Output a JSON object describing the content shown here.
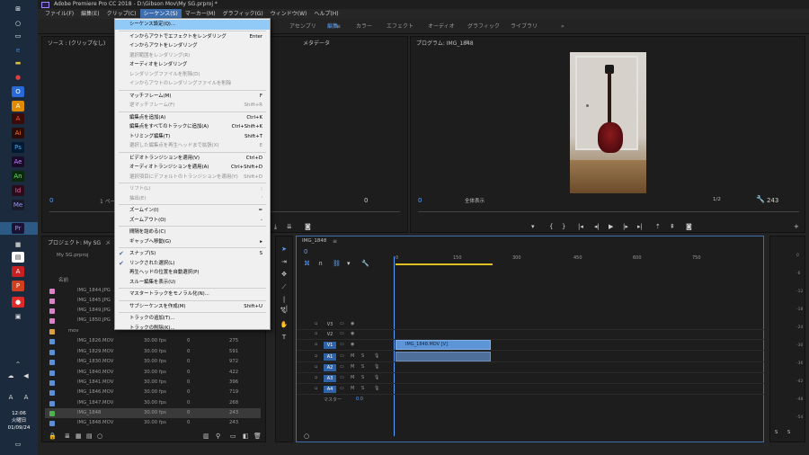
{
  "window": {
    "title": "Adobe Premiere Pro CC 2018 - D:\\Gibson Mov\\My SG.prproj *"
  },
  "menubar": [
    "ファイル(F)",
    "編集(E)",
    "クリップ(C)",
    "シーケンス(S)",
    "マーカー(M)",
    "グラフィック(G)",
    "ウィンドウ(W)",
    "ヘルプ(H)"
  ],
  "workspaces": {
    "items": [
      "アセンブリ",
      "編集",
      "カラー",
      "エフェクト",
      "オーディオ",
      "グラフィック",
      "ライブラリ"
    ],
    "active": "編集",
    "more": "»"
  },
  "source_panel": {
    "title": "ソース : (クリップなし)",
    "tab2": "メタデータ",
    "timecode": "0",
    "page_label": "1 ページ"
  },
  "program_panel": {
    "title": "プログラム: IMG_1848",
    "timecode_left": "0",
    "fit_label": "全体表示",
    "ratio_label": "1/2",
    "duration": "243"
  },
  "project_panel": {
    "title": "プロジェクト: My SG",
    "tab2": "メ",
    "file_label": "My SG.prproj",
    "col_name": "名前",
    "items": [
      {
        "name": "IMG_1844.JPG",
        "fps": "",
        "zero": "",
        "dur": "",
        "color": "#d882c8"
      },
      {
        "name": "IMG_1845.JPG",
        "fps": "",
        "zero": "",
        "dur": "",
        "color": "#d882c8"
      },
      {
        "name": "IMG_1849.JPG",
        "fps": "",
        "zero": "",
        "dur": "",
        "color": "#d882c8"
      },
      {
        "name": "IMG_1850.JPG",
        "fps": "",
        "zero": "",
        "dur": "",
        "color": "#d882c8"
      },
      {
        "name": "mov",
        "fps": "",
        "zero": "",
        "dur": "",
        "color": "#d8a040"
      },
      {
        "name": "IMG_1826.MOV",
        "fps": "30.00 fps",
        "zero": "0",
        "dur": "275",
        "color": "#5b8fd6"
      },
      {
        "name": "IMG_1829.MOV",
        "fps": "30.00 fps",
        "zero": "0",
        "dur": "591",
        "color": "#5b8fd6"
      },
      {
        "name": "IMG_1830.MOV",
        "fps": "30.00 fps",
        "zero": "0",
        "dur": "972",
        "color": "#5b8fd6"
      },
      {
        "name": "IMG_1840.MOV",
        "fps": "30.00 fps",
        "zero": "0",
        "dur": "422",
        "color": "#5b8fd6"
      },
      {
        "name": "IMG_1841.MOV",
        "fps": "30.00 fps",
        "zero": "0",
        "dur": "396",
        "color": "#5b8fd6"
      },
      {
        "name": "IMG_1846.MOV",
        "fps": "30.00 fps",
        "zero": "0",
        "dur": "719",
        "color": "#5b8fd6"
      },
      {
        "name": "IMG_1847.MOV",
        "fps": "30.00 fps",
        "zero": "0",
        "dur": "268",
        "color": "#5b8fd6"
      },
      {
        "name": "IMG_1848",
        "fps": "30.00 fps",
        "zero": "0",
        "dur": "243",
        "color": "#4fb24f"
      },
      {
        "name": "IMG_1848.MOV",
        "fps": "30.00 fps",
        "zero": "0",
        "dur": "243",
        "color": "#5b8fd6"
      }
    ]
  },
  "timeline": {
    "tab": "IMG_1848",
    "timecode": "0",
    "ruler": [
      "0",
      "150",
      "300",
      "450",
      "600",
      "750"
    ],
    "tracks": [
      "V3",
      "V2",
      "V1",
      "A1",
      "A2",
      "A3",
      "A4"
    ],
    "master_label": "マスター",
    "master_value": "0.0",
    "clip_label": "IMG_1848.MOV [V]",
    "m": "M",
    "s": "S"
  },
  "meter": {
    "ticks": [
      "0",
      "-6",
      "-12",
      "-18",
      "-24",
      "-30",
      "-36",
      "-42",
      "-48",
      "-54"
    ],
    "solo": "S"
  },
  "dropdown": {
    "items": [
      {
        "label": "シーケンス設定(Q)...",
        "shortcut": "",
        "state": "hl"
      },
      {
        "sep": true
      },
      {
        "label": "インからアウトでエフェクトをレンダリング",
        "shortcut": "Enter",
        "state": ""
      },
      {
        "label": "インからアウトをレンダリング",
        "shortcut": "",
        "state": ""
      },
      {
        "label": "選択範囲をレンダリング(R)",
        "shortcut": "",
        "state": "dis"
      },
      {
        "label": "オーディオをレンダリング",
        "shortcut": "",
        "state": ""
      },
      {
        "label": "レンダリングファイルを削除(D)",
        "shortcut": "",
        "state": "dis"
      },
      {
        "label": "インからアウトのレンダリングファイルを削除",
        "shortcut": "",
        "state": "dis"
      },
      {
        "sep": true
      },
      {
        "label": "マッチフレーム(M)",
        "shortcut": "F",
        "state": ""
      },
      {
        "label": "逆マッチフレーム(F)",
        "shortcut": "Shift+R",
        "state": "dis"
      },
      {
        "sep": true
      },
      {
        "label": "編集点を追加(A)",
        "shortcut": "Ctrl+K",
        "state": ""
      },
      {
        "label": "編集点をすべてのトラックに追加(A)",
        "shortcut": "Ctrl+Shift+K",
        "state": ""
      },
      {
        "label": "トリミング編集(T)",
        "shortcut": "Shift+T",
        "state": ""
      },
      {
        "label": "選択した編集点を再生ヘッドまで拡張(X)",
        "shortcut": "E",
        "state": "dis"
      },
      {
        "sep": true
      },
      {
        "label": "ビデオトランジションを適用(V)",
        "shortcut": "Ctrl+D",
        "state": ""
      },
      {
        "label": "オーディオトランジションを適用(A)",
        "shortcut": "Ctrl+Shift+D",
        "state": ""
      },
      {
        "label": "選択項目にデフォルトのトランジションを適用(Y)",
        "shortcut": "Shift+D",
        "state": "dis"
      },
      {
        "sep": true
      },
      {
        "label": "リフト(L)",
        "shortcut": ";",
        "state": "dis"
      },
      {
        "label": "抽出(E)",
        "shortcut": "'",
        "state": "dis"
      },
      {
        "sep": true
      },
      {
        "label": "ズームイン(I)",
        "shortcut": "=",
        "state": ""
      },
      {
        "label": "ズームアウト(O)",
        "shortcut": "-",
        "state": ""
      },
      {
        "sep": true
      },
      {
        "label": "間隔を詰める(C)",
        "shortcut": "",
        "state": ""
      },
      {
        "label": "ギャップへ移動(G)",
        "shortcut": "",
        "state": "",
        "arrow": true
      },
      {
        "sep": true
      },
      {
        "label": "スナップ(S)",
        "shortcut": "S",
        "state": "",
        "check": true
      },
      {
        "label": "リンクされた選択(L)",
        "shortcut": "",
        "state": "",
        "check": true
      },
      {
        "label": "再生ヘッドの位置を自動選択(P)",
        "shortcut": "",
        "state": ""
      },
      {
        "label": "スルー編集を表示(U)",
        "shortcut": "",
        "state": ""
      },
      {
        "sep": true
      },
      {
        "label": "マスタートラックをモノラル化(N)...",
        "shortcut": "",
        "state": ""
      },
      {
        "sep": true
      },
      {
        "label": "サブシーケンスを作成(M)",
        "shortcut": "Shift+U",
        "state": ""
      },
      {
        "sep": true
      },
      {
        "label": "トラックの追加(T)...",
        "shortcut": "",
        "state": ""
      },
      {
        "label": "トラックの削除(K)...",
        "shortcut": "",
        "state": ""
      }
    ]
  },
  "clock": {
    "time": "12:06",
    "day": "火曜日",
    "date": "01/09/24"
  },
  "colors": {
    "accent": "#3d6fb0",
    "menu_bg": "#f0f0f0",
    "highlight": "#91c9f7",
    "clip": "#5d95d6",
    "track_on": "#2e63a8",
    "taskbar": "#1b2a3c"
  }
}
